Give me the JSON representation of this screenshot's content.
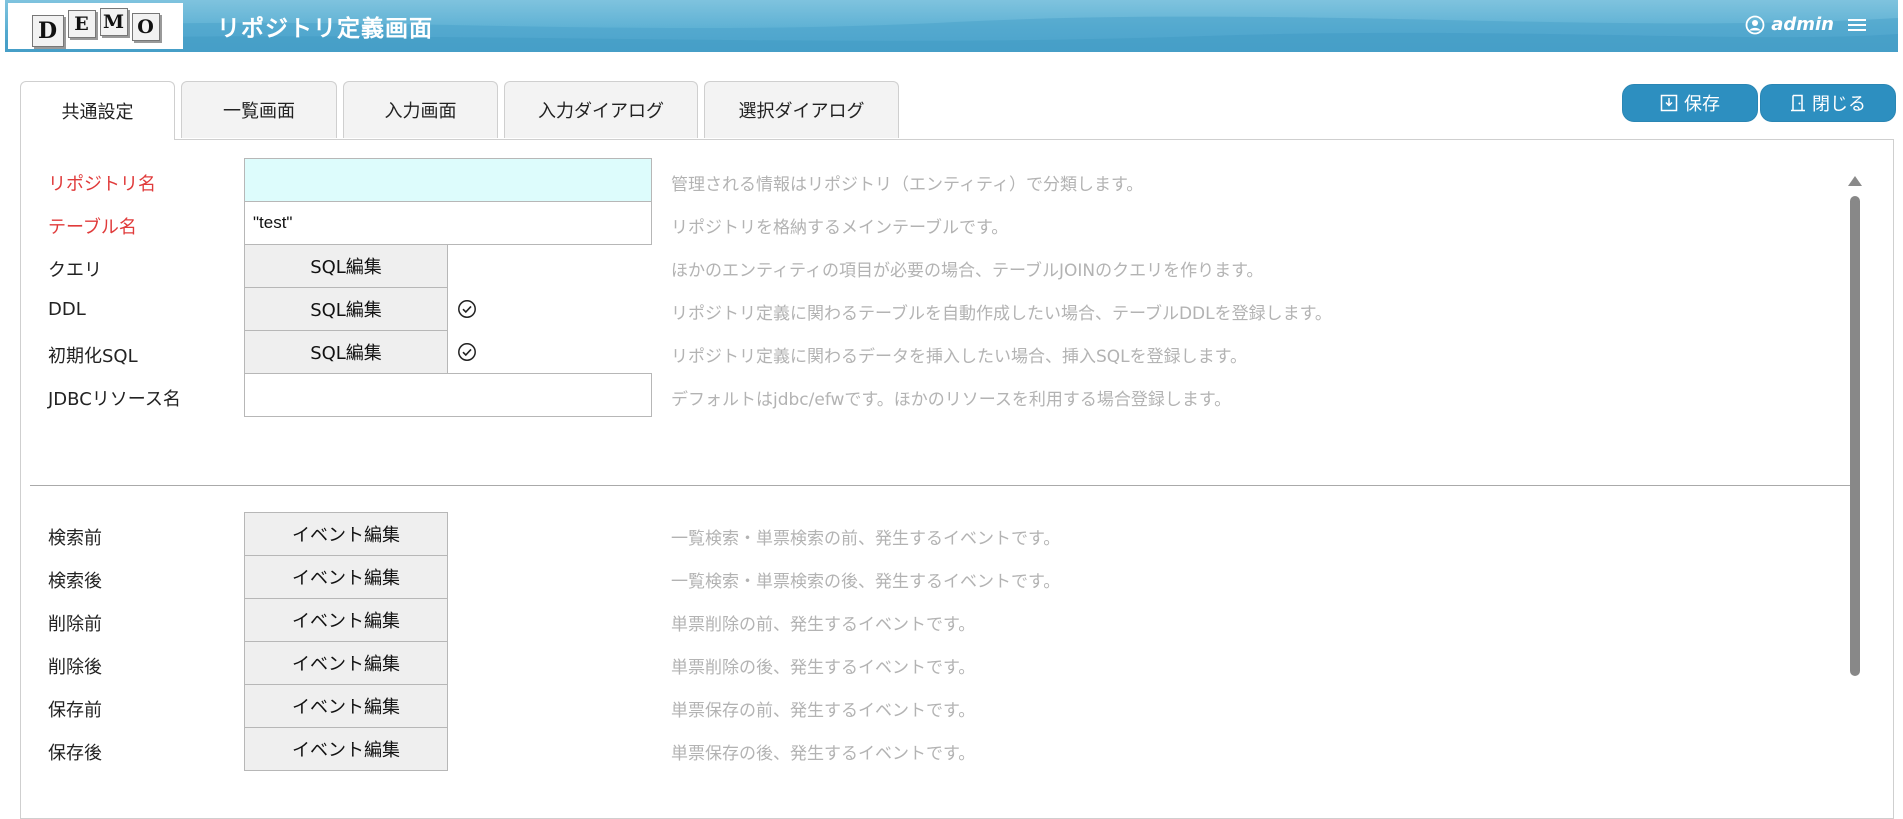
{
  "header": {
    "logo_letters": [
      "D",
      "E",
      "M",
      "O"
    ],
    "title": "リポジトリ定義画面",
    "user": "admin",
    "user_icon": "user-circle-icon",
    "menu_icon": "hamburger-menu-icon",
    "bg_color": "#5eb1d4"
  },
  "tabs": [
    {
      "label": "共通設定",
      "active": true
    },
    {
      "label": "一覧画面",
      "active": false
    },
    {
      "label": "入力画面",
      "active": false
    },
    {
      "label": "入力ダイアログ",
      "active": false
    },
    {
      "label": "選択ダイアログ",
      "active": false
    }
  ],
  "actions": {
    "save_label": "保存",
    "save_icon": "download-box-icon",
    "close_label": "閉じる",
    "close_icon": "door-exit-icon",
    "color": "#2d8fc0"
  },
  "form": {
    "repository_name": {
      "label": "リポジトリ名",
      "value": "",
      "description": "管理される情報はリポジトリ（エンティティ）で分類します。"
    },
    "table_name": {
      "label": "テーブル名",
      "value": "\"test\"",
      "description": "リポジトリを格納するメインテーブルです。"
    },
    "query": {
      "label": "クエリ",
      "button": "SQL編集",
      "description": "ほかのエンティティの項目が必要の場合、テーブルJOINのクエリを作ります。"
    },
    "ddl": {
      "label": "DDL",
      "button": "SQL編集",
      "description": "リポジトリ定義に関わるテーブルを自動作成したい場合、テーブルDDLを登録します。"
    },
    "init_sql": {
      "label": "初期化SQL",
      "button": "SQL編集",
      "description": "リポジトリ定義に関わるデータを挿入したい場合、挿入SQLを登録します。"
    },
    "jdbc": {
      "label": "JDBCリソース名",
      "value": "",
      "description": "デフォルトはjdbc/efwです。ほかのリソースを利用する場合登録します。"
    }
  },
  "events": [
    {
      "label": "検索前",
      "button": "イベント編集",
      "description": "一覧検索・単票検索の前、発生するイベントです。"
    },
    {
      "label": "検索後",
      "button": "イベント編集",
      "description": "一覧検索・単票検索の後、発生するイベントです。"
    },
    {
      "label": "削除前",
      "button": "イベント編集",
      "description": "単票削除の前、発生するイベントです。"
    },
    {
      "label": "削除後",
      "button": "イベント編集",
      "description": "単票削除の後、発生するイベントです。"
    },
    {
      "label": "保存前",
      "button": "イベント編集",
      "description": "単票保存の前、発生するイベントです。"
    },
    {
      "label": "保存後",
      "button": "イベント編集",
      "description": "単票保存の後、発生するイベントです。"
    }
  ],
  "colors": {
    "required_label": "#e03b3b",
    "description": "#b3b3b3",
    "required_input_bg": "#ddfcfc"
  }
}
